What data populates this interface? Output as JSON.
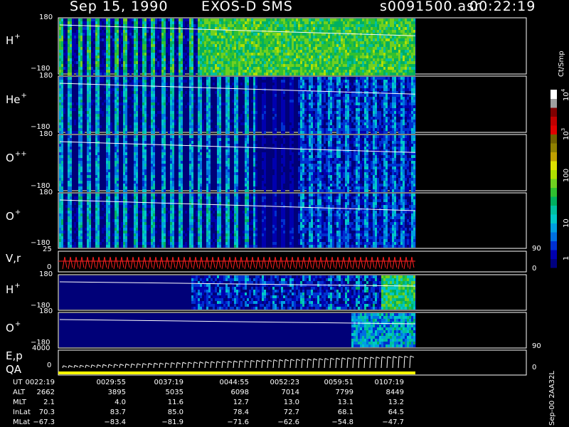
{
  "header": {
    "date": "Sep 15, 1990",
    "mission": "EXOS-D SMS",
    "file": "s0091500.asr",
    "time": "00:22:19"
  },
  "panels": {
    "p1": {
      "ion": "H",
      "charge": "+",
      "top": "180",
      "bot": "−180"
    },
    "p2": {
      "ion": "He",
      "charge": "+",
      "top": "180",
      "bot": "−180"
    },
    "p3": {
      "ion": "O",
      "charge": "++",
      "top": "180",
      "bot": "−180"
    },
    "p4": {
      "ion": "O",
      "charge": "+",
      "top": "180",
      "bot": "−180"
    },
    "p5": {
      "label": "V,r",
      "top": "25",
      "bot": "0",
      "rtop": "90",
      "rbot": "0"
    },
    "p6": {
      "ion": "H",
      "charge": "+",
      "top": "180",
      "bot": "−180"
    },
    "p7": {
      "ion": "O",
      "charge": "+",
      "top": "180",
      "bot": "−180"
    },
    "p8": {
      "label1": "E,p",
      "label2": "QA",
      "top": "4000",
      "bot": "0",
      "rtop": "90",
      "rbot": "0"
    }
  },
  "colorbar": {
    "unit": "Ct/Smp",
    "ticks": [
      "1",
      "10",
      "100",
      "10",
      "10"
    ],
    "exps": [
      "",
      "",
      "",
      "3",
      "4"
    ],
    "colors": [
      "#000080",
      "#0000b0",
      "#0030d0",
      "#0070e0",
      "#00a0e0",
      "#00c8c8",
      "#00c0a0",
      "#00b060",
      "#30c030",
      "#70d020",
      "#b0e000",
      "#e0e000",
      "#c0a000",
      "#908000",
      "#706000",
      "#e00000",
      "#c00000",
      "#800000",
      "#a0a0a0",
      "#ffffff"
    ]
  },
  "ephemeris": {
    "labels": [
      "UT",
      "ALT",
      "MLT",
      "InLat",
      "MLat"
    ],
    "columns": [
      [
        "0022:19",
        "2662",
        "2.1",
        "70.3",
        "−67.3"
      ],
      [
        "0029:55",
        "3895",
        "4.0",
        "83.7",
        "−83.4"
      ],
      [
        "0037:19",
        "5035",
        "11.6",
        "85.0",
        "−81.9"
      ],
      [
        "0044:55",
        "6098",
        "12.7",
        "78.4",
        "−71.6"
      ],
      [
        "0052:23",
        "7014",
        "13.0",
        "72.7",
        "−62.6"
      ],
      [
        "0059:51",
        "7799",
        "13.1",
        "68.1",
        "−54.8"
      ],
      [
        "0107:19",
        "8449",
        "13.2",
        "64.5",
        "−47.7"
      ]
    ]
  },
  "footer": "Sep-00 2AA32L",
  "chart_data": {
    "type": "heatmap",
    "title": "Sep 15, 1990   EXOS-D SMS",
    "x": [
      "0022:19",
      "0029:55",
      "0037:19",
      "0044:55",
      "0052:23",
      "0059:51",
      "0107:19"
    ],
    "series": [
      {
        "name": "H+",
        "ylim": [
          -180,
          180
        ]
      },
      {
        "name": "He+",
        "ylim": [
          -180,
          180
        ]
      },
      {
        "name": "O++",
        "ylim": [
          -180,
          180
        ]
      },
      {
        "name": "O+",
        "ylim": [
          -180,
          180
        ]
      },
      {
        "name": "V,r",
        "ylim": [
          0,
          25
        ],
        "ylim_right": [
          0,
          90
        ]
      },
      {
        "name": "H+",
        "ylim": [
          -180,
          180
        ]
      },
      {
        "name": "O+",
        "ylim": [
          -180,
          180
        ]
      },
      {
        "name": "E,p",
        "ylim": [
          0,
          4000
        ],
        "ylim_right": [
          0,
          90
        ]
      }
    ],
    "colorbar_label": "Ct/Smp",
    "colorbar_scale": "log",
    "colorbar_range": [
      1,
      10000
    ]
  }
}
